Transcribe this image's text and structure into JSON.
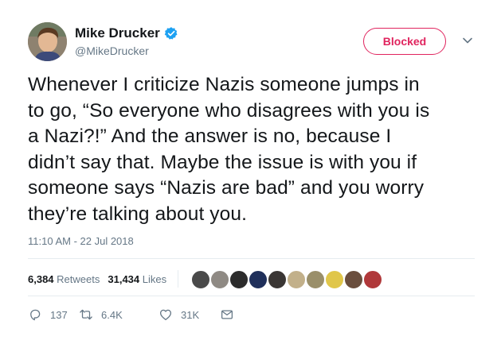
{
  "user": {
    "name": "Mike Drucker",
    "handle": "@MikeDrucker"
  },
  "follow_button": {
    "label": "Blocked"
  },
  "tweet": {
    "lines": [
      "Whenever I criticize Nazis someone jumps in",
      "to go, “So everyone who disagrees with you is",
      "a Nazi?!” And the answer is no, because I",
      "didn’t say that. Maybe the issue is with you if",
      "someone says “Nazis are bad” and you worry",
      "they’re talking about you."
    ],
    "timestamp": "11:10 AM - 22 Jul 2018"
  },
  "stats": {
    "retweets_count": "6,384",
    "retweets_label": "Retweets",
    "likes_count": "31,434",
    "likes_label": "Likes"
  },
  "liker_avatars": [
    {
      "color": "#4a4a4a"
    },
    {
      "color": "#8f8a84"
    },
    {
      "color": "#2c2c2c"
    },
    {
      "color": "#1f2f5a"
    },
    {
      "color": "#3a3634"
    },
    {
      "color": "#c2b08a"
    },
    {
      "color": "#9a8f6a"
    },
    {
      "color": "#e0c64a"
    },
    {
      "color": "#6a4e3d"
    },
    {
      "color": "#b0383a"
    }
  ],
  "actions": {
    "reply_count": "137",
    "retweet_count": "6.4K",
    "like_count": "31K"
  },
  "colors": {
    "verified": "#1da1f2",
    "blocked": "#e0245e",
    "secondary": "#657786",
    "divider": "#e6ecf0"
  }
}
